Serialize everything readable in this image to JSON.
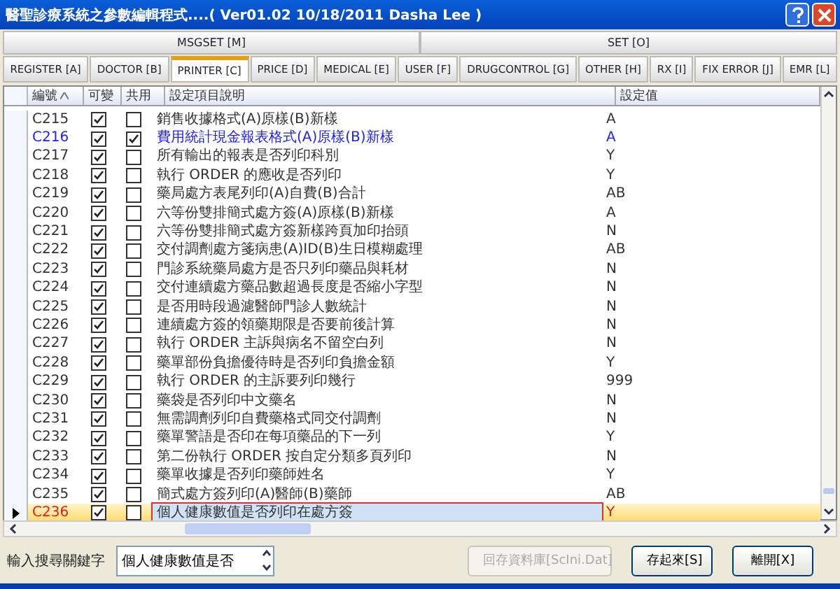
{
  "window": {
    "title": "醫聖診療系統之參數編輯程式....( Ver01.02 10/18/2011 Dasha Lee )"
  },
  "tab_groups": [
    {
      "label": "MSGSET [M]"
    },
    {
      "label": "SET [O]"
    }
  ],
  "tabs": [
    {
      "label": "REGISTER [A]",
      "selected": false
    },
    {
      "label": "DOCTOR [B]",
      "selected": false
    },
    {
      "label": "PRINTER [C]",
      "selected": true
    },
    {
      "label": "PRICE [D]",
      "selected": false
    },
    {
      "label": "MEDICAL [E]",
      "selected": false
    },
    {
      "label": "USER [F]",
      "selected": false
    },
    {
      "label": "DRUGCONTROL [G]",
      "selected": false
    },
    {
      "label": "OTHER [H]",
      "selected": false
    },
    {
      "label": "RX [I]",
      "selected": false
    },
    {
      "label": "FIX ERROR [J]",
      "selected": false
    },
    {
      "label": "EMR [L]",
      "selected": false
    }
  ],
  "table": {
    "columns": [
      "編號",
      "可變",
      "共用",
      "設定項目說明",
      "設定值"
    ],
    "rows": [
      {
        "code": "C215",
        "changeable": true,
        "shared": false,
        "description": "銷售收據格式(A)原樣(B)新樣",
        "value": "A",
        "modified": false,
        "selected": false
      },
      {
        "code": "C216",
        "changeable": true,
        "shared": true,
        "description": "費用統計現金報表格式(A)原樣(B)新樣",
        "value": "A",
        "modified": true,
        "selected": false
      },
      {
        "code": "C217",
        "changeable": true,
        "shared": false,
        "description": "所有輸出的報表是否列印科別",
        "value": "Y",
        "modified": false,
        "selected": false
      },
      {
        "code": "C218",
        "changeable": true,
        "shared": false,
        "description": "執行 ORDER 的應收是否列印",
        "value": "Y",
        "modified": false,
        "selected": false
      },
      {
        "code": "C219",
        "changeable": true,
        "shared": false,
        "description": "藥局處方表尾列印(A)自費(B)合計",
        "value": "AB",
        "modified": false,
        "selected": false
      },
      {
        "code": "C220",
        "changeable": true,
        "shared": false,
        "description": "六等份雙排簡式處方簽(A)原樣(B)新樣",
        "value": "A",
        "modified": false,
        "selected": false
      },
      {
        "code": "C221",
        "changeable": true,
        "shared": false,
        "description": "六等份雙排簡式處方簽新樣跨頁加印抬頭",
        "value": "N",
        "modified": false,
        "selected": false
      },
      {
        "code": "C222",
        "changeable": true,
        "shared": false,
        "description": "交付調劑處方箋病患(A)ID(B)生日模糊處理",
        "value": "AB",
        "modified": false,
        "selected": false
      },
      {
        "code": "C223",
        "changeable": true,
        "shared": false,
        "description": "門診系統藥局處方是否只列印藥品與耗材",
        "value": "N",
        "modified": false,
        "selected": false
      },
      {
        "code": "C224",
        "changeable": true,
        "shared": false,
        "description": "交付連續處方藥品數超過長度是否縮小字型",
        "value": "N",
        "modified": false,
        "selected": false
      },
      {
        "code": "C225",
        "changeable": true,
        "shared": false,
        "description": "是否用時段過濾醫師門診人數統計",
        "value": "N",
        "modified": false,
        "selected": false
      },
      {
        "code": "C226",
        "changeable": true,
        "shared": false,
        "description": "連續處方簽的領藥期限是否要前後計算",
        "value": "N",
        "modified": false,
        "selected": false
      },
      {
        "code": "C227",
        "changeable": true,
        "shared": false,
        "description": "執行 ORDER 主訴與病名不留空白列",
        "value": "N",
        "modified": false,
        "selected": false
      },
      {
        "code": "C228",
        "changeable": true,
        "shared": false,
        "description": "藥單部份負擔優待時是否列印負擔金額",
        "value": "Y",
        "modified": false,
        "selected": false
      },
      {
        "code": "C229",
        "changeable": true,
        "shared": false,
        "description": "執行 ORDER 的主訴要列印幾行",
        "value": "999",
        "modified": false,
        "selected": false
      },
      {
        "code": "C230",
        "changeable": true,
        "shared": false,
        "description": "藥袋是否列印中文藥名",
        "value": "N",
        "modified": false,
        "selected": false
      },
      {
        "code": "C231",
        "changeable": true,
        "shared": false,
        "description": "無需調劑列印自費藥格式同交付調劑",
        "value": "N",
        "modified": false,
        "selected": false
      },
      {
        "code": "C232",
        "changeable": true,
        "shared": false,
        "description": "藥單警語是否印在每項藥品的下一列",
        "value": "Y",
        "modified": false,
        "selected": false
      },
      {
        "code": "C233",
        "changeable": true,
        "shared": false,
        "description": "第二份執行 ORDER 按自定分類多頁列印",
        "value": "N",
        "modified": false,
        "selected": false
      },
      {
        "code": "C234",
        "changeable": true,
        "shared": false,
        "description": "藥單收據是否列印藥師姓名",
        "value": "Y",
        "modified": false,
        "selected": false
      },
      {
        "code": "C235",
        "changeable": true,
        "shared": false,
        "description": "簡式處方簽列印(A)醫師(B)藥師",
        "value": "AB",
        "modified": false,
        "selected": false
      },
      {
        "code": "C236",
        "changeable": true,
        "shared": false,
        "description": "個人健康數值是否列印在處方簽",
        "value": "Y",
        "modified": false,
        "selected": true
      }
    ]
  },
  "search": {
    "label": "輸入搜尋關鍵字",
    "value": "個人健康數值是否"
  },
  "buttons": [
    {
      "label": "回存資料庫[ScIni.Dat]",
      "disabled": true
    },
    {
      "label": "存起來[S]",
      "disabled": false
    },
    {
      "label": "離開[X]",
      "disabled": false
    }
  ]
}
